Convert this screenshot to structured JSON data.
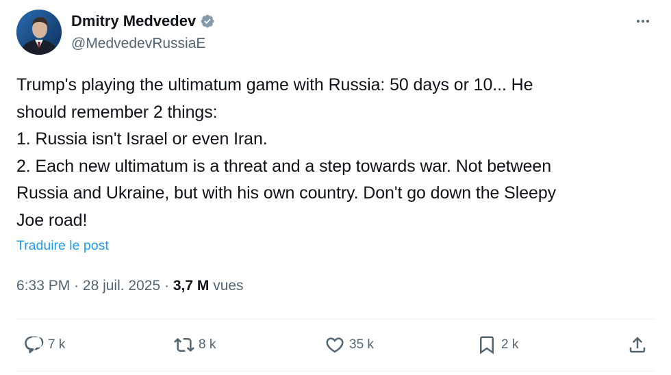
{
  "author": {
    "name": "Dmitry Medvedev",
    "handle": "@MedvedevRussiaE",
    "verified": true
  },
  "more_icon": "more-horizontal-icon",
  "tweet": {
    "lines": [
      "Trump's playing the ultimatum game with Russia: 50 days or 10... He",
      "should remember 2 things:",
      "1. Russia isn't Israel or even Iran.",
      "2. Each new ultimatum is a threat and a step towards war. Not between",
      "Russia and Ukraine, but with his own country. Don't go down the Sleepy",
      "Joe road!"
    ],
    "translate_label": "Traduire le post"
  },
  "meta": {
    "time": "6:33 PM",
    "separator1": " · ",
    "date": "28 juil. 2025",
    "separator2": " · ",
    "views_count": "3,7 M",
    "views_label": " vues"
  },
  "actions": {
    "replies": "7 k",
    "retweets": "8 k",
    "likes": "35 k",
    "bookmarks": "2 k"
  },
  "colors": {
    "text": "#0f1419",
    "secondary": "#536471",
    "link": "#1d9bf0",
    "verified": "#829aab",
    "divider": "#eff3f4"
  }
}
